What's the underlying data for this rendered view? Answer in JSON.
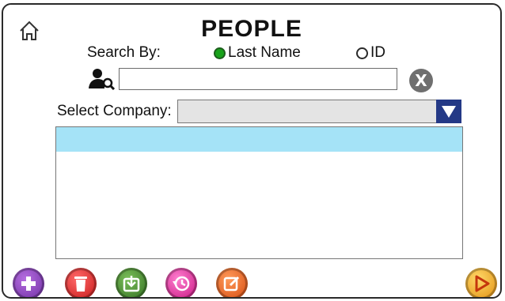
{
  "header": {
    "title": "PEOPLE"
  },
  "search": {
    "search_by_label": "Search By:",
    "options": [
      {
        "label": "Last Name",
        "selected": true
      },
      {
        "label": "ID",
        "selected": false
      }
    ],
    "value": "",
    "clear_symbol": "X"
  },
  "company": {
    "label": "Select Company:",
    "value": ""
  },
  "list": {
    "rows": [
      {
        "label": "",
        "highlighted": true
      }
    ]
  },
  "toolbar": {
    "buttons": [
      {
        "name": "add",
        "icon": "plus-icon"
      },
      {
        "name": "delete",
        "icon": "trash-icon"
      },
      {
        "name": "export",
        "icon": "download-tray-icon"
      },
      {
        "name": "history",
        "icon": "history-clock-icon"
      },
      {
        "name": "edit",
        "icon": "edit-pencil-icon"
      },
      {
        "name": "next",
        "icon": "play-arrow-icon"
      }
    ]
  },
  "colors": {
    "list_highlight": "#a5e3f7",
    "dropdown_button": "#243986",
    "radio_selected": "#18a21a"
  }
}
